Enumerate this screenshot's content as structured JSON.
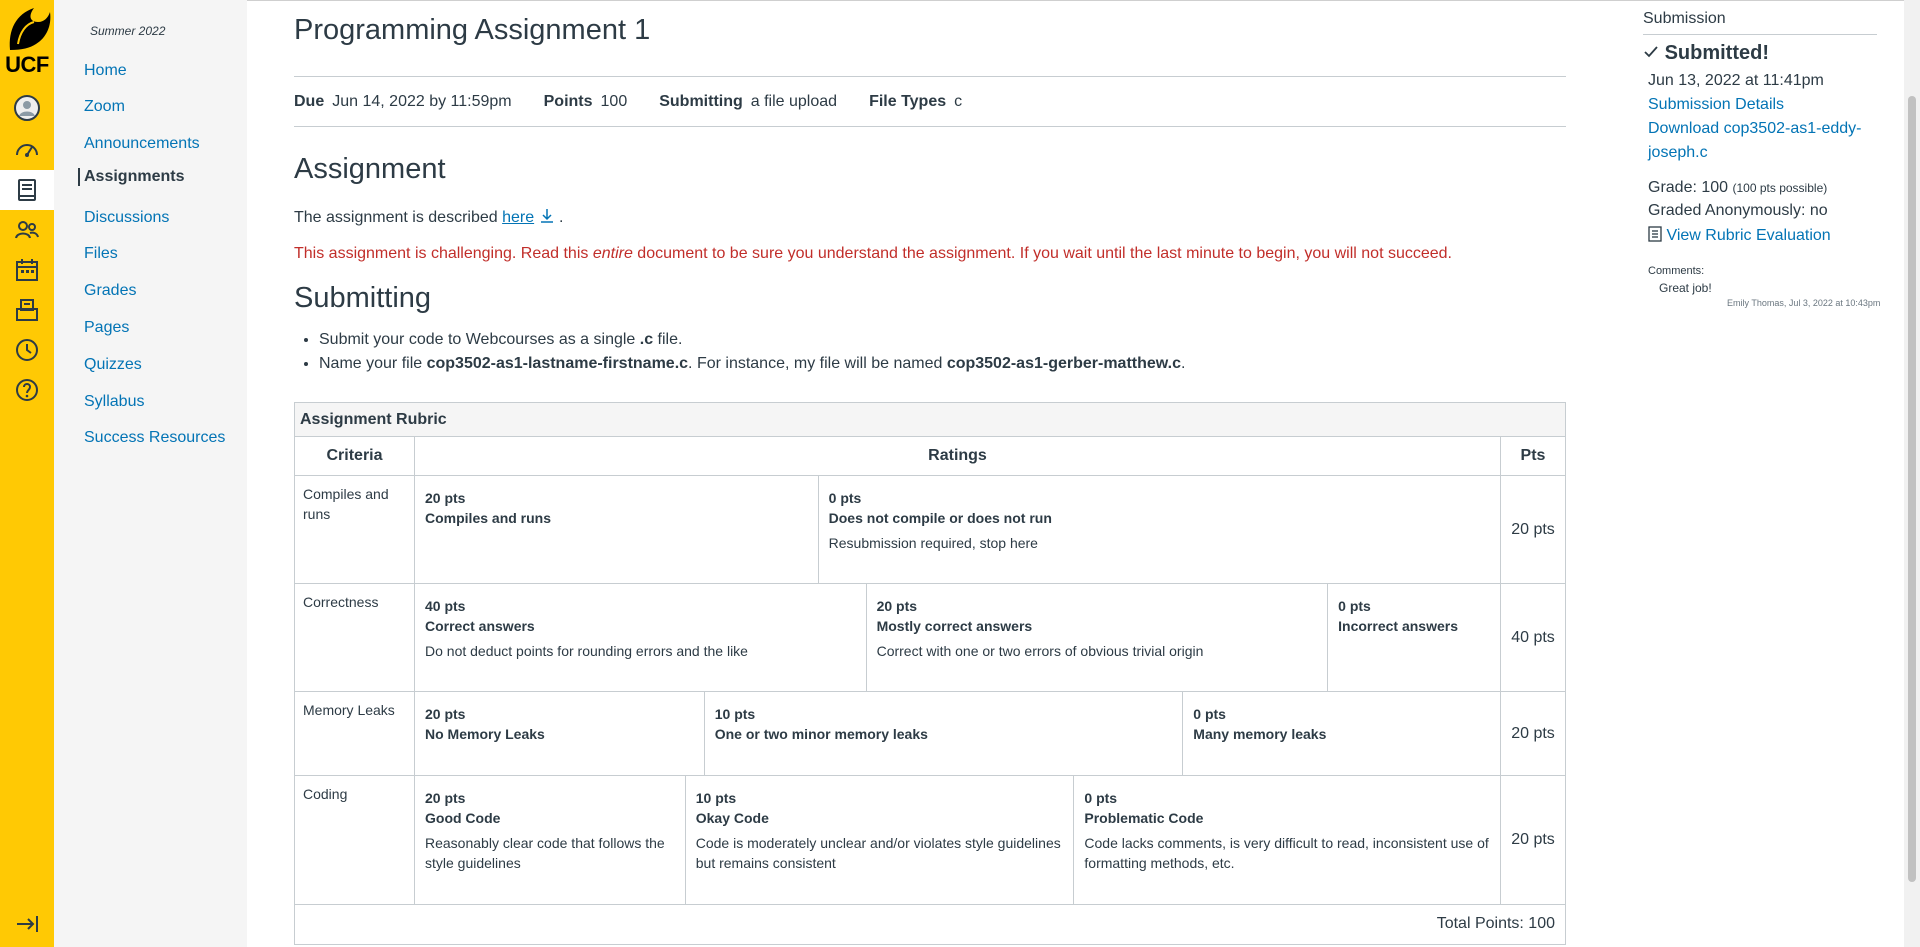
{
  "global_nav": {
    "logo_text": "UCF",
    "items": [
      {
        "icon": "account-avatar-icon",
        "active": false
      },
      {
        "icon": "dashboard-icon",
        "active": false
      },
      {
        "icon": "courses-icon",
        "active": true
      },
      {
        "icon": "groups-icon",
        "active": false
      },
      {
        "icon": "calendar-icon",
        "active": false
      },
      {
        "icon": "inbox-icon",
        "active": false
      },
      {
        "icon": "history-icon",
        "active": false
      },
      {
        "icon": "help-icon",
        "active": false
      }
    ],
    "collapse_icon": "collapse-nav-icon"
  },
  "course_nav": {
    "term": "Summer 2022",
    "items": [
      "Home",
      "Zoom",
      "Announcements",
      "Assignments",
      "Discussions",
      "Files",
      "Grades",
      "Pages",
      "Quizzes",
      "Syllabus",
      "Success Resources"
    ],
    "active": "Assignments"
  },
  "assignment": {
    "title": "Programming Assignment 1",
    "due_label": "Due",
    "due_value": "Jun 14, 2022 by 11:59pm",
    "points_label": "Points",
    "points_value": "100",
    "submitting_label": "Submitting",
    "submitting_value": "a file upload",
    "filetypes_label": "File Types",
    "filetypes_value": "c",
    "section_assignment": "Assignment",
    "desc_pre": "The assignment is described ",
    "desc_link": "here",
    "desc_post": " .",
    "warning_1": "This assignment is challenging.  Read this ",
    "warning_em": "entire",
    "warning_2": " document to be sure you understand the assignment.  If you wait until the last minute to begin, you will not succeed.",
    "section_submitting": "Submitting",
    "bullet_1_pre": "Submit your code to Webcourses as a single ",
    "bullet_1_bold": ".c",
    "bullet_1_post": " file.",
    "bullet_2_pre": "Name your file ",
    "bullet_2_bold": "cop3502-as1-lastname-firstname.c",
    "bullet_2_mid": ".  For instance, my file will be named ",
    "bullet_2_bold2": "cop3502-as1-gerber-matthew.c",
    "bullet_2_post": "."
  },
  "rubric": {
    "title": "Assignment Rubric",
    "headers": {
      "criteria": "Criteria",
      "ratings": "Ratings",
      "pts": "Pts"
    },
    "rows": [
      {
        "criterion": "Compiles and runs",
        "pts": "20 pts",
        "ratings": [
          {
            "pts": "20 pts",
            "title": "Compiles and runs",
            "desc": ""
          },
          {
            "pts": "0 pts",
            "title": "Does not compile or does not run",
            "desc": "Resubmission required, stop here"
          }
        ]
      },
      {
        "criterion": "Correctness",
        "pts": "40 pts",
        "ratings": [
          {
            "pts": "40 pts",
            "title": "Correct answers",
            "desc": "Do not deduct points for rounding errors and the like"
          },
          {
            "pts": "20 pts",
            "title": "Mostly correct answers",
            "desc": "Correct with one or two errors of obvious trivial origin"
          },
          {
            "pts": "0 pts",
            "title": "Incorrect answers",
            "desc": ""
          }
        ]
      },
      {
        "criterion": "Memory Leaks",
        "pts": "20 pts",
        "ratings": [
          {
            "pts": "20 pts",
            "title": "No Memory Leaks",
            "desc": ""
          },
          {
            "pts": "10 pts",
            "title": "One or two minor memory leaks",
            "desc": ""
          },
          {
            "pts": "0 pts",
            "title": "Many memory leaks",
            "desc": ""
          }
        ]
      },
      {
        "criterion": "Coding",
        "pts": "20 pts",
        "ratings": [
          {
            "pts": "20 pts",
            "title": "Good Code",
            "desc": "Reasonably clear code that follows the style guidelines"
          },
          {
            "pts": "10 pts",
            "title": "Okay Code",
            "desc": "Code is moderately unclear and/or violates style guidelines but remains consistent"
          },
          {
            "pts": "0 pts",
            "title": "Problematic Code",
            "desc": "Code lacks comments, is very difficult to read, inconsistent use of formatting methods, etc."
          }
        ]
      }
    ],
    "total": "Total Points: 100"
  },
  "submission": {
    "header": "Submission",
    "status": "Submitted!",
    "date": "Jun 13, 2022 at 11:41pm",
    "details_link": "Submission Details",
    "download_link_1": "Download cop3502-as1-eddy-",
    "download_link_2": "joseph.c",
    "grade_label": "Grade: 100",
    "grade_possible": "(100 pts possible)",
    "graded_anon": "Graded Anonymously: no",
    "rubric_link": "View Rubric Evaluation",
    "comments_label": "Comments:",
    "comment_text": "Great job!",
    "comment_meta": "Emily Thomas, Jul 3, 2022 at 10:43pm"
  },
  "colors": {
    "brand_gold": "#ffc904",
    "link_blue": "#0374b5",
    "warning_red": "#c12e2a"
  }
}
